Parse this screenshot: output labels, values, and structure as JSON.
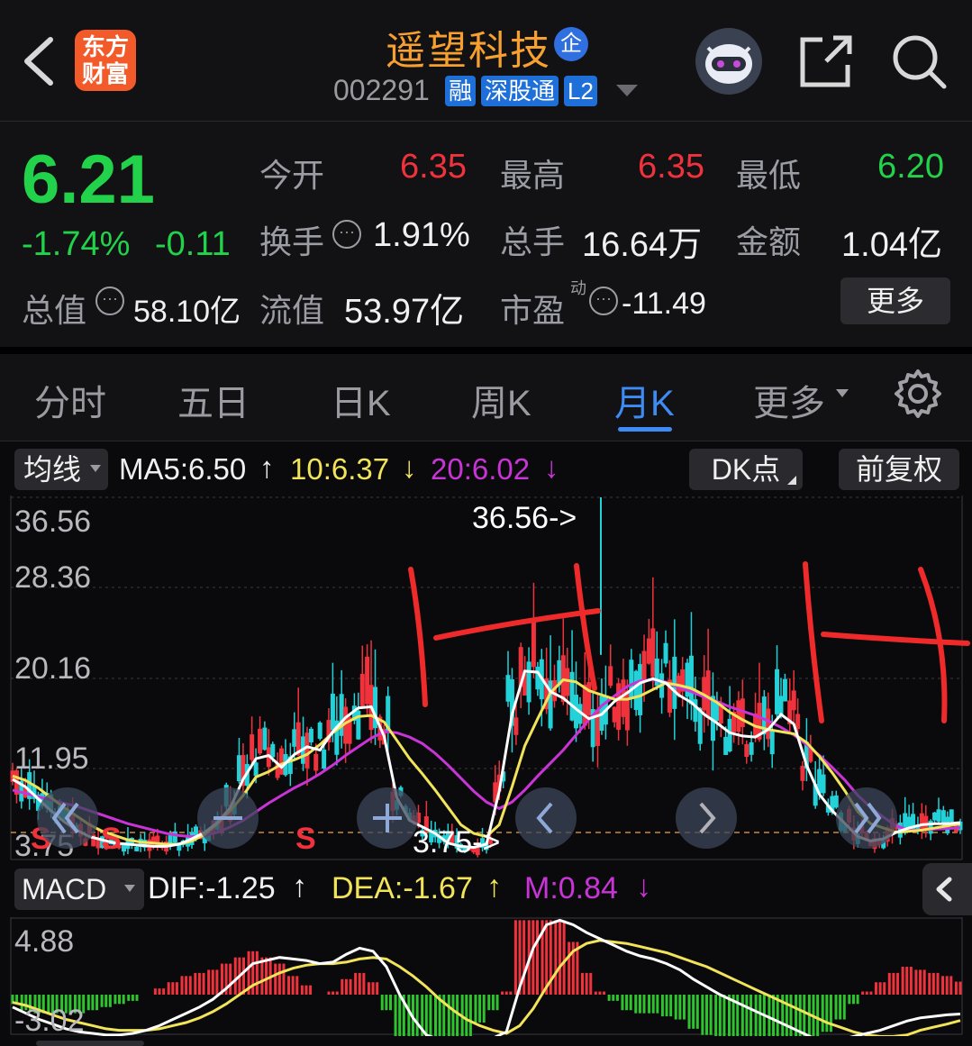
{
  "header": {
    "back_icon": "chevron-left-icon",
    "logo_text": [
      "东方",
      "财富"
    ],
    "stock_name": "遥望科技",
    "qi_badge": "企",
    "stock_code": "002291",
    "tags": [
      "融",
      "深股通",
      "L2"
    ],
    "share_icon": "share-icon",
    "search_icon": "search-icon"
  },
  "quote": {
    "price": "6.21",
    "change_pct": "-1.74%",
    "change": "-0.11",
    "open_label": "今开",
    "open": "6.35",
    "high_label": "最高",
    "high": "6.35",
    "low_label": "最低",
    "low": "6.20",
    "turnover_label": "换手",
    "turnover": "1.91%",
    "volume_label": "总手",
    "volume": "16.64万",
    "amount_label": "金额",
    "amount": "1.04亿",
    "mktcap_label": "总值",
    "mktcap": "58.10亿",
    "float_label": "流值",
    "float": "53.97亿",
    "pe_label": "市盈",
    "pe_sup": "动",
    "pe": "-11.49",
    "more_label": "更多"
  },
  "tabs": [
    "分时",
    "五日",
    "日K",
    "周K",
    "月K",
    "更多"
  ],
  "active_tab": "月K",
  "indicator_bar": {
    "ma_button": "均线",
    "ma5": "MA5:6.50",
    "ma10": "10:6.37",
    "ma20": "20:6.02",
    "dk_button": "DK点",
    "fq_button": "前复权"
  },
  "macd_bar": {
    "button": "MACD",
    "dif": "DIF:-1.25",
    "dea": "DEA:-1.67",
    "m": "M:0.84"
  },
  "colors": {
    "up": "#f0323c",
    "down": "#22d2d8",
    "ma5": "#ffffff",
    "ma10": "#f2e45a",
    "ma20": "#c934d6",
    "active": "#3d8cf5"
  },
  "chart_data": [
    {
      "type": "candlestick",
      "axis_labels": [
        "36.56",
        "28.36",
        "20.16",
        "11.95",
        "3.75"
      ],
      "max_marker": "36.56->",
      "min_marker": "3.75->",
      "signals": [
        "S",
        "S",
        "S"
      ],
      "ma5": [
        10.5,
        9.8,
        8.7,
        7.6,
        6.6,
        5.8,
        5.2,
        4.9,
        4.6,
        4.5,
        4.4,
        4.3,
        4.3,
        4.5,
        5.0,
        5.6,
        6.5,
        7.9,
        10.5,
        12.4,
        12.7,
        11.6,
        12.8,
        13.5,
        13.2,
        14.9,
        16.2,
        17.1,
        17.2,
        14.5,
        8.8,
        6.7,
        6.1,
        5.5,
        4.6,
        4.3,
        4.2,
        4.5,
        9.4,
        16.5,
        20.5,
        20.4,
        18.6,
        18.0,
        17.0,
        16.1,
        16.5,
        17.7,
        18.5,
        19.4,
        19.8,
        19.4,
        18.3,
        17.6,
        16.5,
        15.7,
        14.8,
        14.5,
        14.4,
        15.1,
        16.5,
        15.6,
        11.8,
        9.1,
        7.6,
        6.4,
        5.2,
        4.8,
        5.0,
        5.6,
        6.0,
        6.3,
        6.4,
        6.4,
        6.5
      ],
      "ma10": [
        10.8,
        10.4,
        9.7,
        8.8,
        7.9,
        7.1,
        6.3,
        5.7,
        5.3,
        4.9,
        4.7,
        4.6,
        4.5,
        4.5,
        4.8,
        5.4,
        6.4,
        7.6,
        9.0,
        10.7,
        11.2,
        11.9,
        12.3,
        12.8,
        13.7,
        14.8,
        15.7,
        16.3,
        16.4,
        15.8,
        14.1,
        12.4,
        11.0,
        9.5,
        7.9,
        6.3,
        5.5,
        5.2,
        6.3,
        9.8,
        13.6,
        16.1,
        18.5,
        19.7,
        19.5,
        18.7,
        18.3,
        17.9,
        17.9,
        18.2,
        18.8,
        19.4,
        19.2,
        18.9,
        18.3,
        17.6,
        16.7,
        16.0,
        15.4,
        15.1,
        14.9,
        14.7,
        13.9,
        12.6,
        11.1,
        9.4,
        7.5,
        6.4,
        6.0,
        5.6,
        5.7,
        5.8,
        6.0,
        6.2,
        6.37
      ],
      "ma20": [
        9.5,
        9.2,
        8.9,
        8.6,
        8.3,
        8.0,
        7.6,
        7.2,
        6.8,
        6.4,
        6.1,
        5.8,
        5.5,
        5.3,
        5.2,
        5.3,
        5.6,
        6.1,
        6.7,
        7.5,
        8.3,
        9.0,
        9.7,
        10.3,
        11.0,
        11.8,
        12.7,
        13.5,
        14.3,
        14.9,
        14.8,
        14.4,
        13.8,
        12.9,
        11.8,
        10.6,
        9.4,
        8.4,
        7.8,
        8.4,
        9.5,
        10.8,
        12.0,
        13.2,
        14.6,
        16.0,
        17.3,
        18.2,
        19.1,
        19.6,
        19.7,
        19.5,
        19.0,
        18.6,
        18.1,
        17.7,
        17.2,
        16.8,
        16.4,
        15.9,
        15.3,
        14.6,
        13.7,
        12.7,
        11.6,
        10.4,
        9.0,
        7.9,
        7.0,
        6.2,
        5.8,
        5.8,
        5.9,
        5.95,
        6.02
      ]
    },
    {
      "type": "macd",
      "axis_labels": [
        "4.88",
        "-3.02"
      ],
      "dif": [
        -0.8,
        -1.2,
        -1.6,
        -1.9,
        -2.2,
        -2.4,
        -2.5,
        -2.6,
        -2.6,
        -2.5,
        -2.3,
        -2.0,
        -1.6,
        -1.2,
        -0.8,
        -0.3,
        0.4,
        1.2,
        2.0,
        2.2,
        2.4,
        2.3,
        2.2,
        2.0,
        2.1,
        2.6,
        3.0,
        2.8,
        1.8,
        0.0,
        -1.5,
        -2.6,
        -2.9,
        -3.0,
        -3.0,
        -2.9,
        -2.8,
        -2.4,
        0.5,
        3.0,
        4.5,
        4.8,
        4.5,
        4.0,
        3.6,
        3.2,
        2.8,
        2.5,
        2.3,
        2.0,
        1.6,
        1.0,
        0.5,
        0.0,
        -0.4,
        -0.8,
        -1.2,
        -1.6,
        -2.0,
        -2.4,
        -2.8,
        -3.0,
        -2.9,
        -2.7,
        -2.5,
        -2.3,
        -2.0,
        -1.7,
        -1.5,
        -1.4,
        -1.3,
        -1.25
      ],
      "dea": [
        -0.5,
        -0.7,
        -1.0,
        -1.3,
        -1.6,
        -1.8,
        -2.0,
        -2.2,
        -2.3,
        -2.3,
        -2.3,
        -2.2,
        -2.0,
        -1.8,
        -1.5,
        -1.1,
        -0.6,
        0.0,
        0.6,
        1.0,
        1.4,
        1.7,
        1.9,
        2.0,
        2.0,
        2.1,
        2.3,
        2.4,
        2.3,
        1.8,
        1.2,
        0.5,
        -0.3,
        -1.0,
        -1.6,
        -2.0,
        -2.3,
        -2.5,
        -2.0,
        -0.9,
        0.5,
        1.8,
        2.8,
        3.3,
        3.5,
        3.4,
        3.3,
        3.1,
        2.9,
        2.7,
        2.4,
        2.1,
        1.8,
        1.4,
        1.0,
        0.6,
        0.2,
        -0.2,
        -0.6,
        -1.0,
        -1.4,
        -1.8,
        -2.1,
        -2.4,
        -2.6,
        -2.7,
        -2.7,
        -2.6,
        -2.3,
        -2.1,
        -1.9,
        -1.67
      ]
    }
  ]
}
